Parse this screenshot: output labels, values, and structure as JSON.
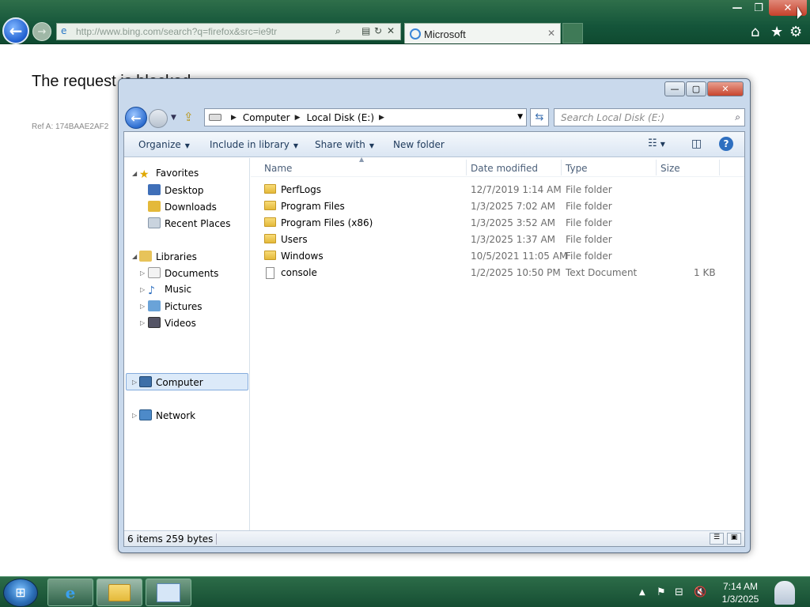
{
  "browser": {
    "url": "http://www.bing.com/search?q=firefox&src=ie9tr",
    "tab_title": "Microsoft",
    "tab_close": "✕",
    "window": {
      "minimize": "—",
      "restore": "❐",
      "close": "✕"
    }
  },
  "page": {
    "heading": "The request is blocked.",
    "ref": "Ref A: 174BAAE2AF2"
  },
  "explorer": {
    "breadcrumb": [
      "Computer",
      "Local Disk (E:)"
    ],
    "search_placeholder": "Search Local Disk (E:)",
    "commands": {
      "organize": "Organize",
      "include_in_library": "Include in library",
      "share_with": "Share with",
      "new_folder": "New folder"
    },
    "nav": {
      "favorites": "Favorites",
      "desktop": "Desktop",
      "downloads": "Downloads",
      "recent_places": "Recent Places",
      "libraries": "Libraries",
      "documents": "Documents",
      "music": "Music",
      "pictures": "Pictures",
      "videos": "Videos",
      "computer": "Computer",
      "network": "Network"
    },
    "columns": {
      "name": "Name",
      "date_modified": "Date modified",
      "type": "Type",
      "size": "Size"
    },
    "files": [
      {
        "name": "PerfLogs",
        "date": "12/7/2019 1:14 AM",
        "type": "File folder",
        "size": "",
        "icon": "folder-icon"
      },
      {
        "name": "Program Files",
        "date": "1/3/2025 7:02 AM",
        "type": "File folder",
        "size": "",
        "icon": "folder-icon"
      },
      {
        "name": "Program Files (x86)",
        "date": "1/3/2025 3:52 AM",
        "type": "File folder",
        "size": "",
        "icon": "folder-icon"
      },
      {
        "name": "Users",
        "date": "1/3/2025 1:37 AM",
        "type": "File folder",
        "size": "",
        "icon": "folder-icon"
      },
      {
        "name": "Windows",
        "date": "10/5/2021 11:05 AM",
        "type": "File folder",
        "size": "",
        "icon": "folder-icon"
      },
      {
        "name": "console",
        "date": "1/2/2025 10:50 PM",
        "type": "Text Document",
        "size": "1 KB",
        "icon": "text-file-icon"
      }
    ],
    "status": "6 items  259 bytes"
  },
  "taskbar": {
    "time": "7:14 AM",
    "date": "1/3/2025"
  }
}
